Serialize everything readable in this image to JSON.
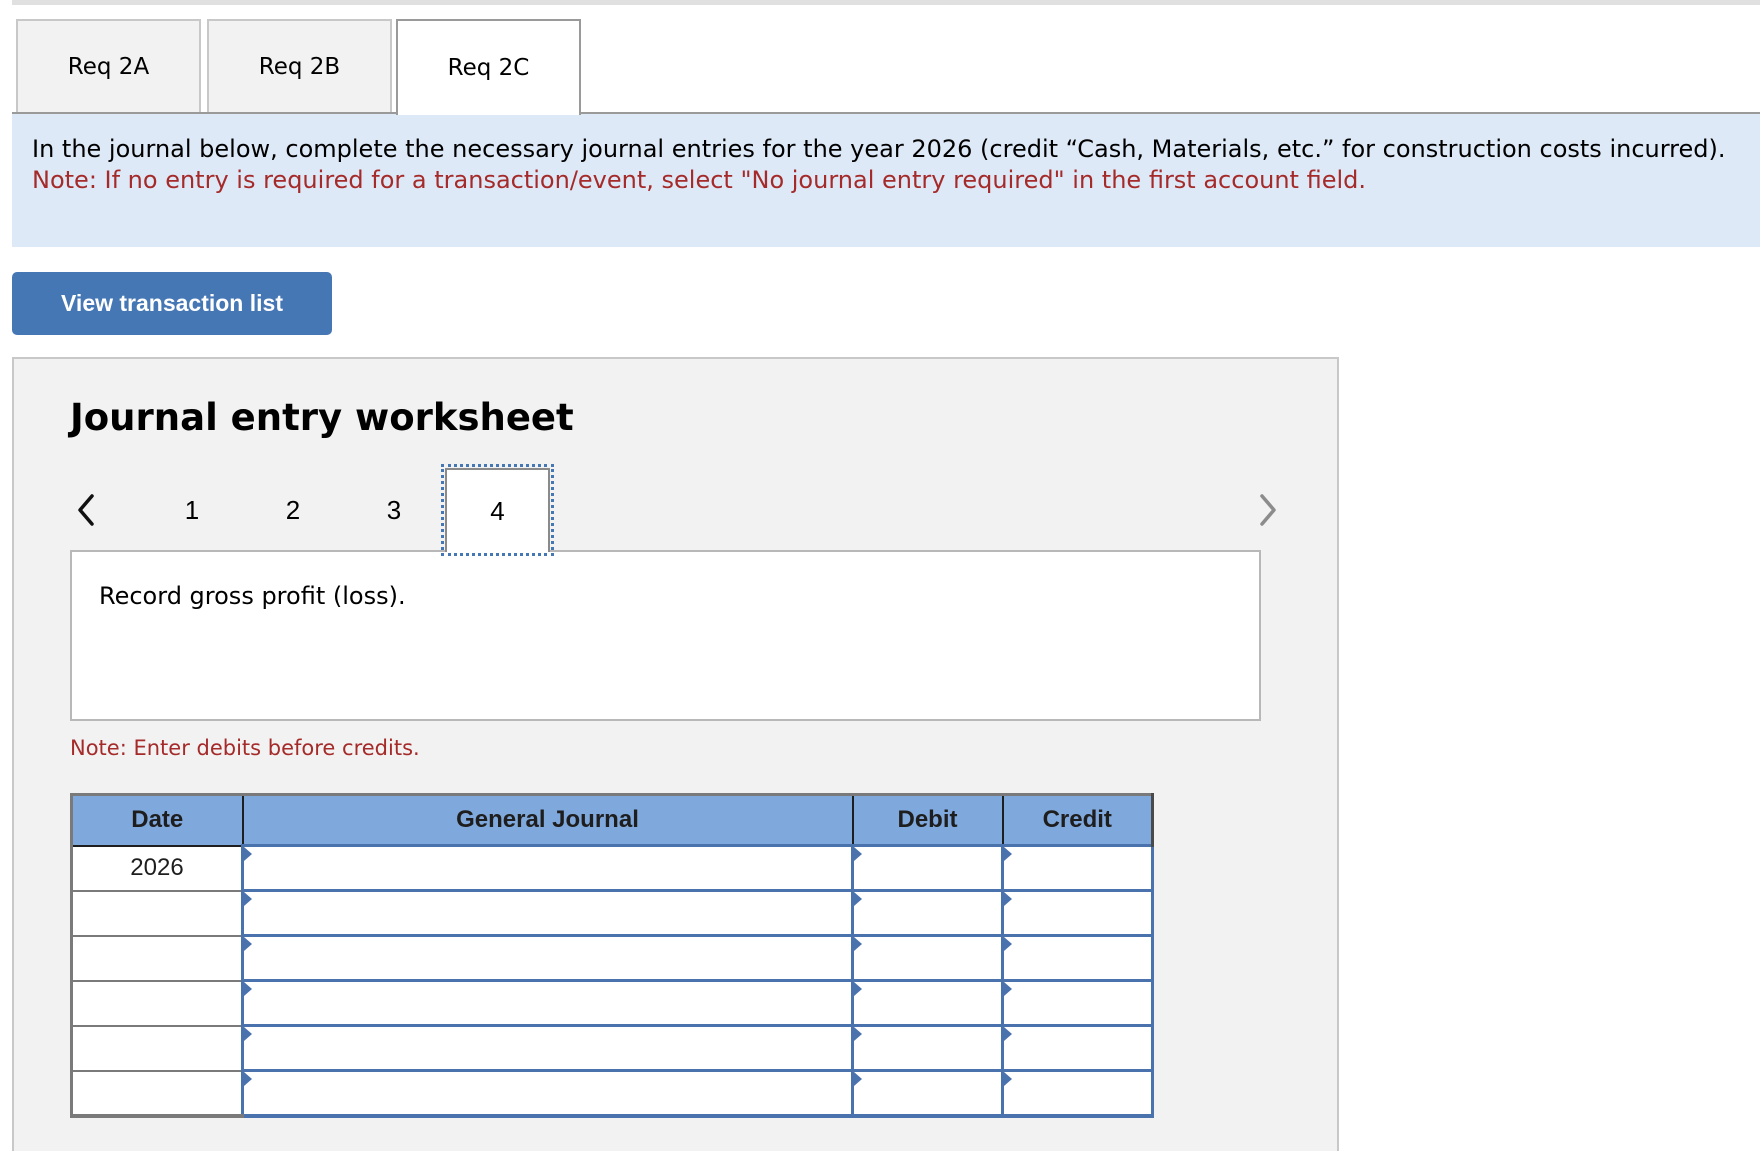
{
  "tabs": [
    {
      "label": "Req 2A",
      "active": false
    },
    {
      "label": "Req 2B",
      "active": false
    },
    {
      "label": "Req 2C",
      "active": true
    }
  ],
  "instructions": {
    "text": "In the journal below, complete the necessary journal entries for the year 2026 (credit “Cash, Materials, etc.” for construction costs incurred).",
    "note": "Note: If no entry is required for a transaction/event, select \"No journal entry required\" in the first account field."
  },
  "view_transactions_button": "View transaction list",
  "worksheet": {
    "title": "Journal entry worksheet",
    "pager": {
      "prev_icon": "chevron-left-icon",
      "next_icon": "chevron-right-icon",
      "pages": [
        "1",
        "2",
        "3",
        "4"
      ],
      "current_page": "4"
    },
    "description": "Record gross profit (loss).",
    "note": "Note: Enter debits before credits.",
    "table": {
      "headers": [
        "Date",
        "General Journal",
        "Debit",
        "Credit"
      ],
      "rows": [
        {
          "date": "2026",
          "account": "",
          "debit": "",
          "credit": ""
        },
        {
          "date": "",
          "account": "",
          "debit": "",
          "credit": ""
        },
        {
          "date": "",
          "account": "",
          "debit": "",
          "credit": ""
        },
        {
          "date": "",
          "account": "",
          "debit": "",
          "credit": ""
        },
        {
          "date": "",
          "account": "",
          "debit": "",
          "credit": ""
        },
        {
          "date": "",
          "account": "",
          "debit": "",
          "credit": ""
        }
      ]
    }
  },
  "colors": {
    "accent_blue": "#4677b5",
    "header_blue": "#7fa8dc",
    "intro_bg": "#dde9f7",
    "note_red": "#a52a2a",
    "panel_bg": "#f2f2f2"
  }
}
